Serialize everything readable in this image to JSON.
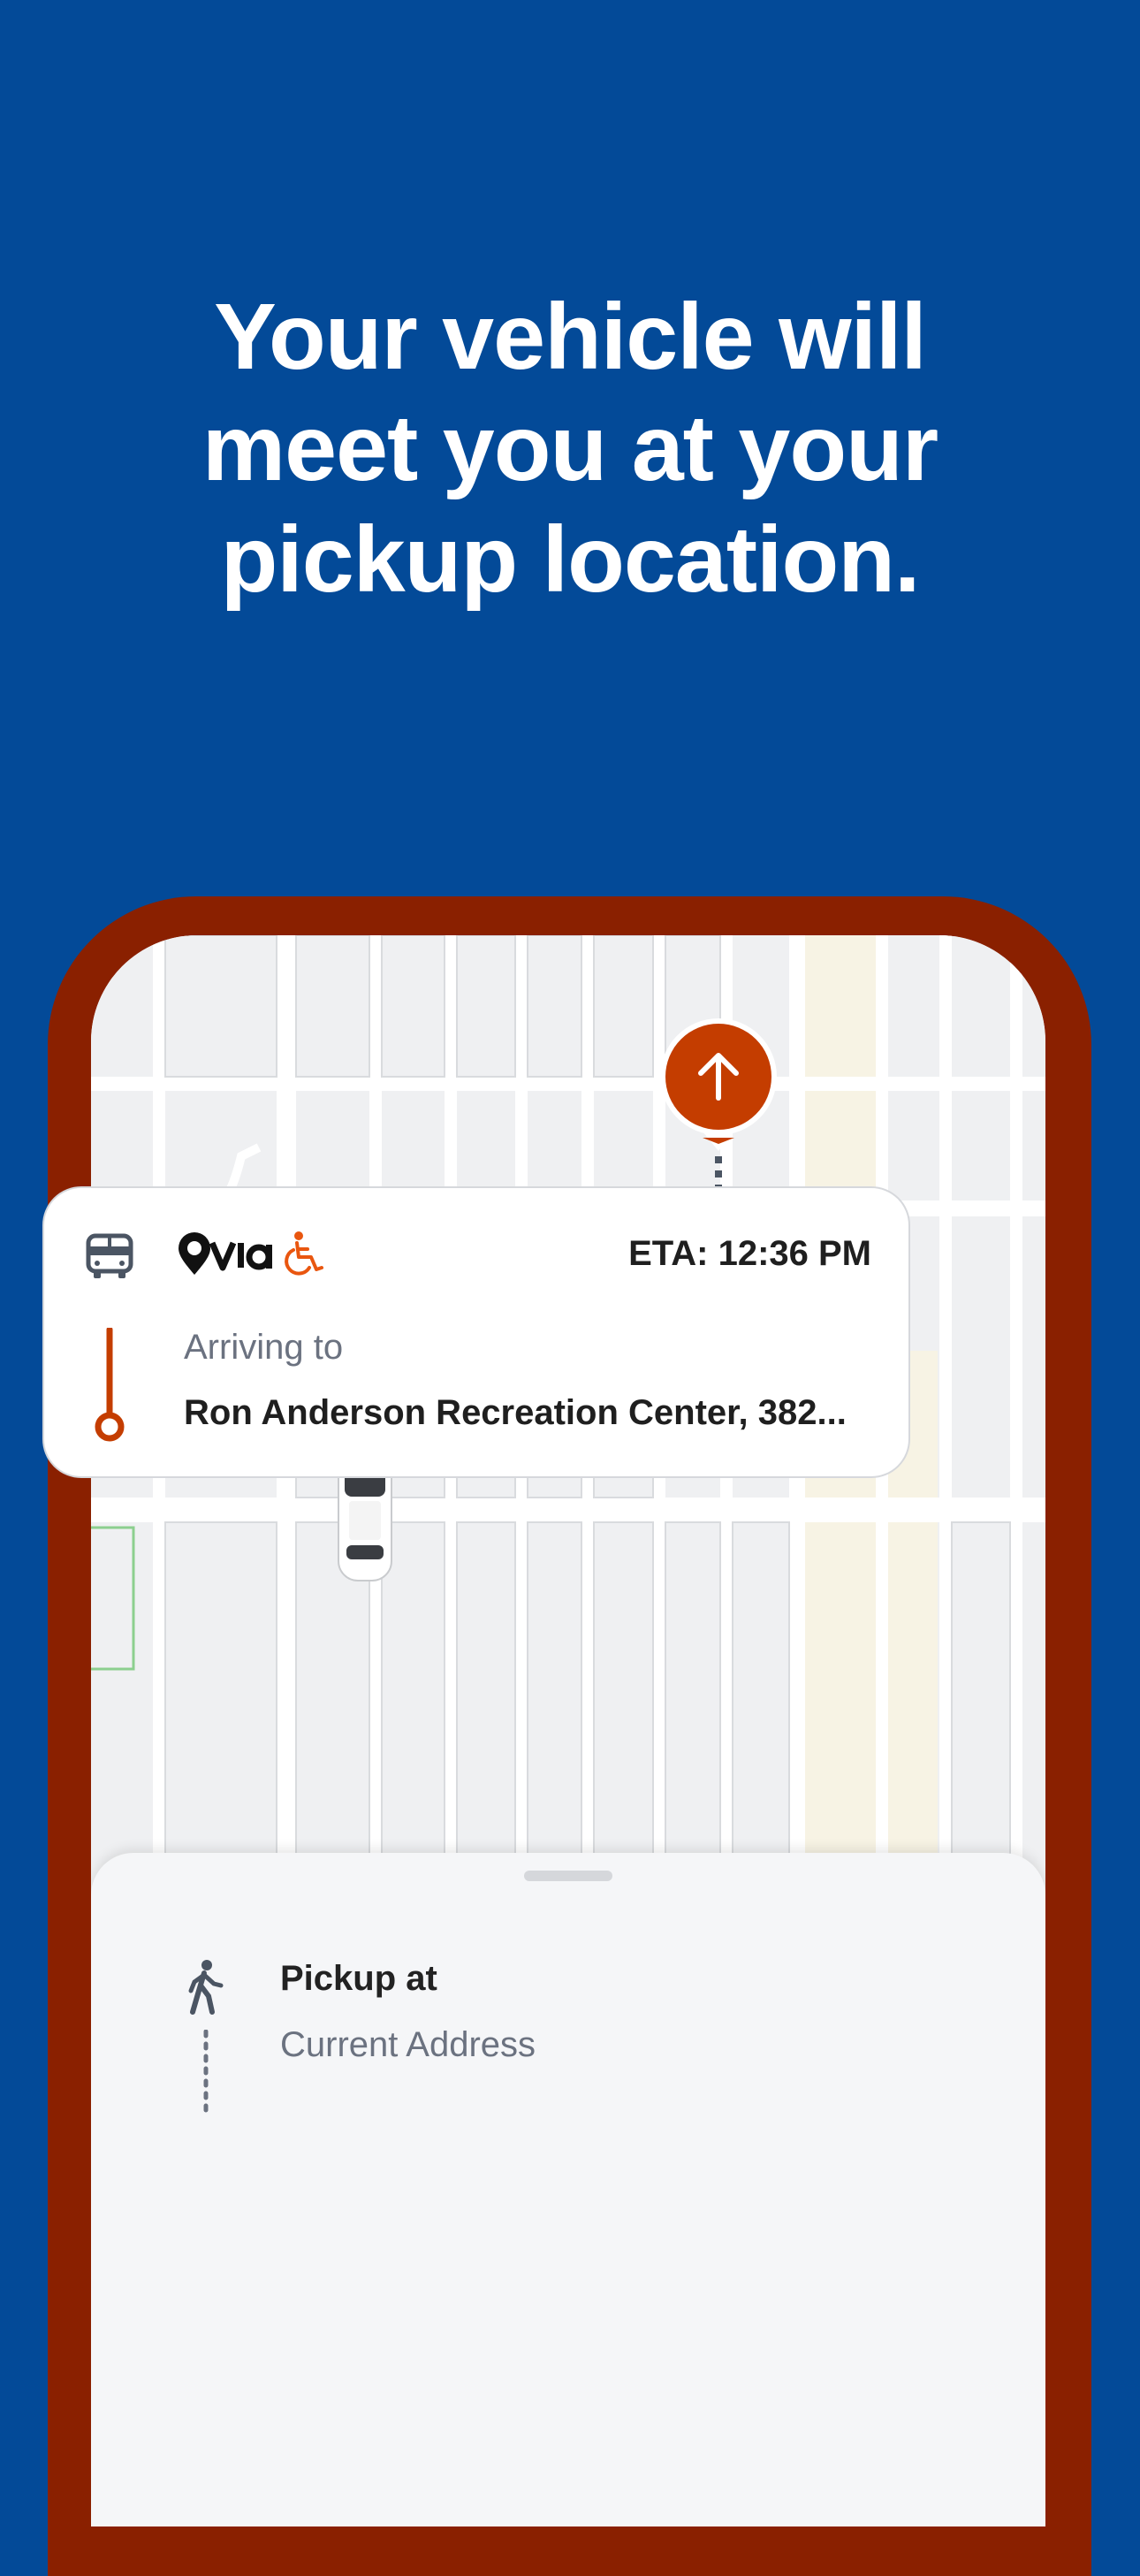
{
  "headline": {
    "line1": "Your vehicle will",
    "line2": "meet you at your",
    "line3": "pickup location."
  },
  "colors": {
    "background": "#034a98",
    "phone_frame": "#8a2000",
    "route": "#e9560f",
    "pickup_pin": "#c43d00",
    "user_location": "#0a68e0"
  },
  "map": {
    "pickup_pin_icon": "arrow-up-icon",
    "vehicle_icon": "car-icon",
    "user_location_icon": "location-dot-icon"
  },
  "pickup": {
    "title": "Pickup at",
    "address": "Current Address",
    "icon": "walking-person-icon"
  },
  "ride_card": {
    "vehicle_icon": "van-icon",
    "brand_logo": "via",
    "accessibility_icon": "wheelchair-icon",
    "eta": "ETA: 12:36 PM",
    "arriving_label": "Arriving to",
    "destination": "Ron Anderson Recreation Center, 382..."
  }
}
